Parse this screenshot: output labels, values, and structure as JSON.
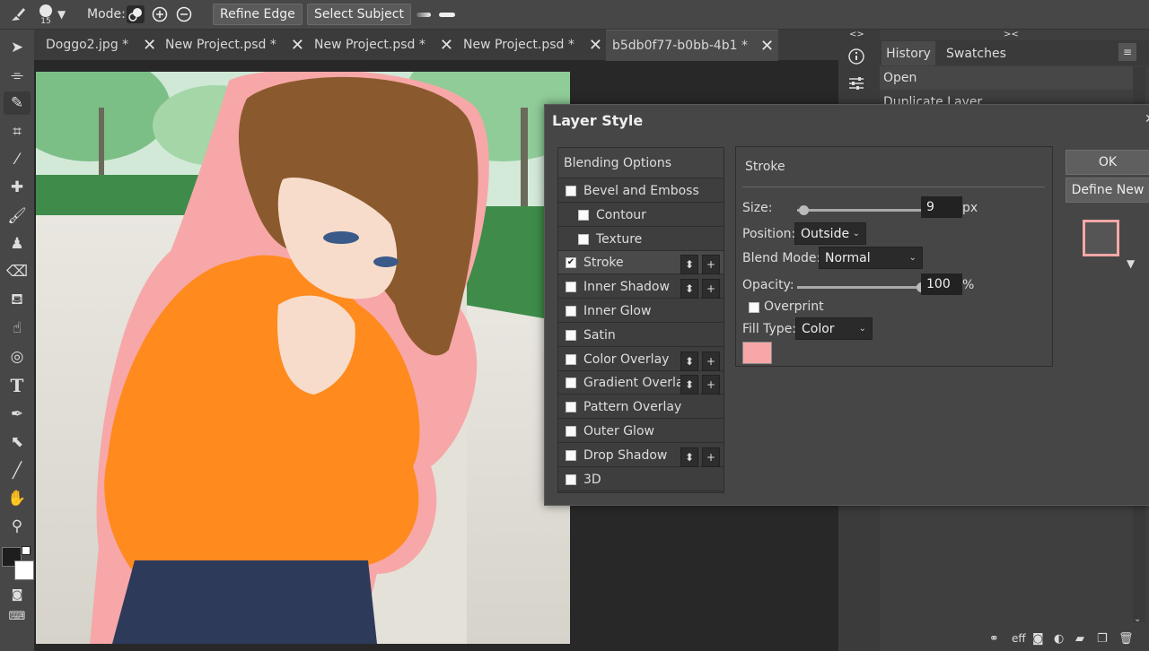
{
  "toolbar": {
    "brush_size": "15",
    "mode_label": "Mode:",
    "refine_edge": "Refine Edge",
    "select_subject": "Select Subject"
  },
  "tabs": [
    {
      "label": "Doggo2.jpg *"
    },
    {
      "label": "New Project.psd *"
    },
    {
      "label": "New Project.psd *"
    },
    {
      "label": "New Project.psd *"
    },
    {
      "label": "b5db0f77-b0bb-4b1 *"
    }
  ],
  "right_panel": {
    "collapse_left": "<>",
    "collapse_right": "><",
    "tab_history": "History",
    "tab_swatches": "Swatches",
    "history_items": [
      "Open",
      "Duplicate Layer"
    ],
    "footer_eff": "eff"
  },
  "dialog": {
    "title": "Layer Style",
    "blending_options": "Blending Options",
    "styles": [
      {
        "label": "Bevel and Emboss",
        "checked": false,
        "indent": false,
        "ctrls": false
      },
      {
        "label": "Contour",
        "checked": false,
        "indent": true,
        "ctrls": false
      },
      {
        "label": "Texture",
        "checked": false,
        "indent": true,
        "ctrls": false
      },
      {
        "label": "Stroke",
        "checked": true,
        "indent": false,
        "ctrls": true
      },
      {
        "label": "Inner Shadow",
        "checked": false,
        "indent": false,
        "ctrls": true
      },
      {
        "label": "Inner Glow",
        "checked": false,
        "indent": false,
        "ctrls": false
      },
      {
        "label": "Satin",
        "checked": false,
        "indent": false,
        "ctrls": false
      },
      {
        "label": "Color Overlay",
        "checked": false,
        "indent": false,
        "ctrls": true
      },
      {
        "label": "Gradient Overlay",
        "checked": false,
        "indent": false,
        "ctrls": true
      },
      {
        "label": "Pattern Overlay",
        "checked": false,
        "indent": false,
        "ctrls": false
      },
      {
        "label": "Outer Glow",
        "checked": false,
        "indent": false,
        "ctrls": false
      },
      {
        "label": "Drop Shadow",
        "checked": false,
        "indent": false,
        "ctrls": true
      },
      {
        "label": "3D",
        "checked": false,
        "indent": false,
        "ctrls": false
      }
    ],
    "stroke": {
      "heading": "Stroke",
      "size_label": "Size:",
      "size_value": "9",
      "size_unit": "px",
      "size_slider_fraction": 0.05,
      "position_label": "Position:",
      "position_value": "Outside",
      "blend_label": "Blend Mode:",
      "blend_value": "Normal",
      "opacity_label": "Opacity:",
      "opacity_value": "100",
      "opacity_unit": "%",
      "opacity_slider_fraction": 1.0,
      "overprint_label": "Overprint",
      "overprint_checked": false,
      "fill_type_label": "Fill Type:",
      "fill_type_value": "Color",
      "fill_color": "#f7a7a7"
    },
    "ok": "OK",
    "define_new": "Define New"
  },
  "colors": {
    "stroke_pink": "#f7a7a7",
    "sweater": "#ff8a1e",
    "hair": "#8a5a2e",
    "skirt": "#2e3a5a"
  }
}
